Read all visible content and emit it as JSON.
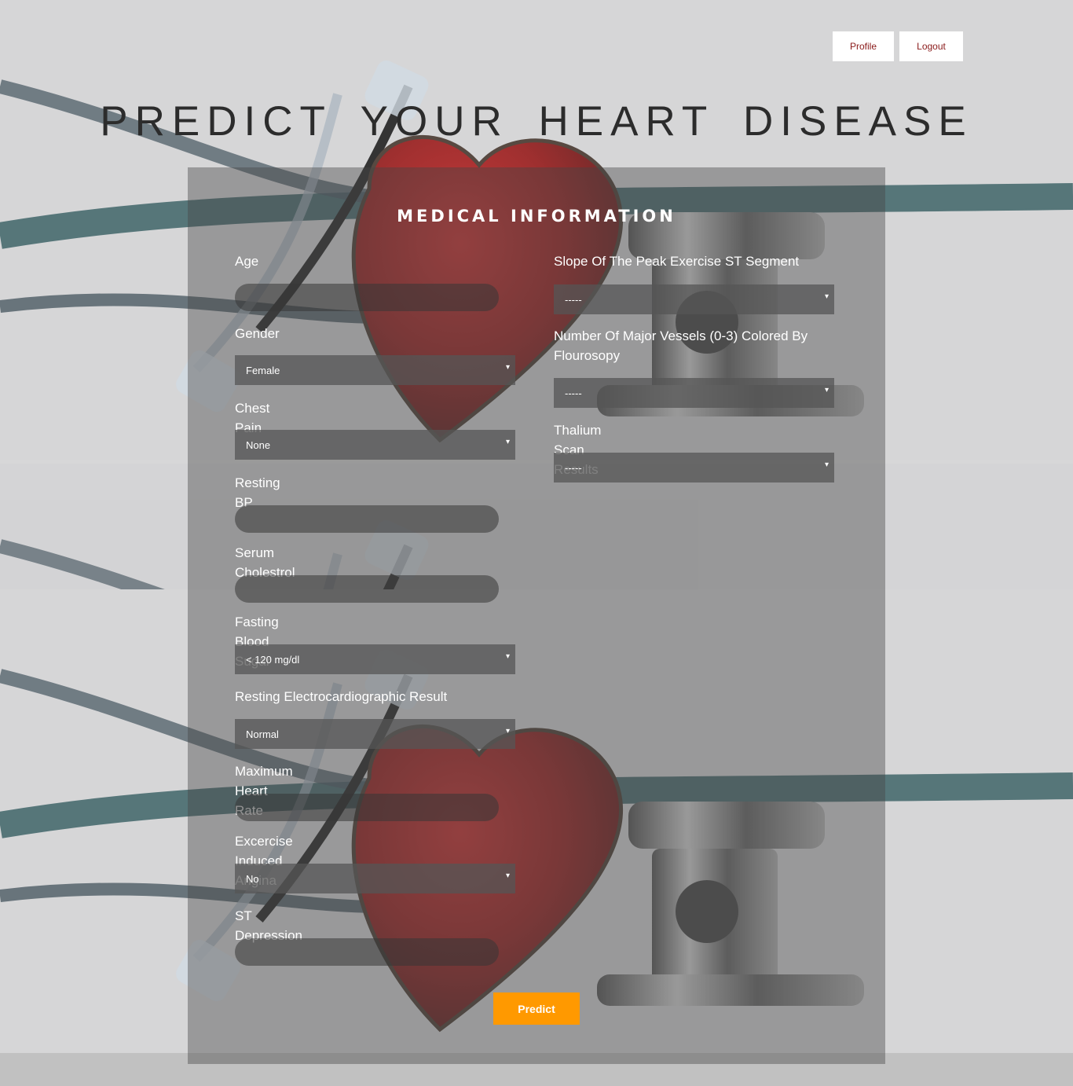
{
  "nav": {
    "profile_label": "Profile",
    "logout_label": "Logout"
  },
  "page_title": "PREDICT YOUR HEART DISEASE",
  "form": {
    "title": "MEDICAL INFORMATION",
    "left_column": {
      "age": {
        "label": "Age",
        "value": ""
      },
      "gender": {
        "label": "Gender",
        "selected": "Female"
      },
      "chest_pain": {
        "label": "Chest Pain",
        "selected": "None"
      },
      "resting_bp": {
        "label": "Resting BP",
        "value": ""
      },
      "serum_cholestrol": {
        "label": "Serum Cholestrol",
        "value": ""
      },
      "fasting_blood_sugar": {
        "label": "Fasting Blood Sugar",
        "selected": "< 120 mg/dl"
      },
      "resting_ecg": {
        "label": "Resting Electrocardiographic Result",
        "selected": "Normal"
      },
      "max_heart_rate": {
        "label": "Maximum Heart Rate",
        "value": ""
      },
      "exercise_angina": {
        "label": "Excercise Induced Angina",
        "selected": "No"
      },
      "st_depression": {
        "label": "ST Depression",
        "value": ""
      }
    },
    "right_column": {
      "slope": {
        "label": "Slope Of The Peak Exercise ST Segment",
        "selected": "-----"
      },
      "major_vessels": {
        "label": "Number Of Major Vessels (0-3) Colored By Flourosopy",
        "selected": "-----"
      },
      "thalium": {
        "label": "Thalium Scan Results",
        "selected": "-----"
      }
    },
    "predict_label": "Predict"
  },
  "icons": {
    "dropdown_arrow": "▾"
  },
  "colors": {
    "accent": "#ff9900",
    "nav_text": "#8a1a1a",
    "panel": "#5a5a5a"
  }
}
